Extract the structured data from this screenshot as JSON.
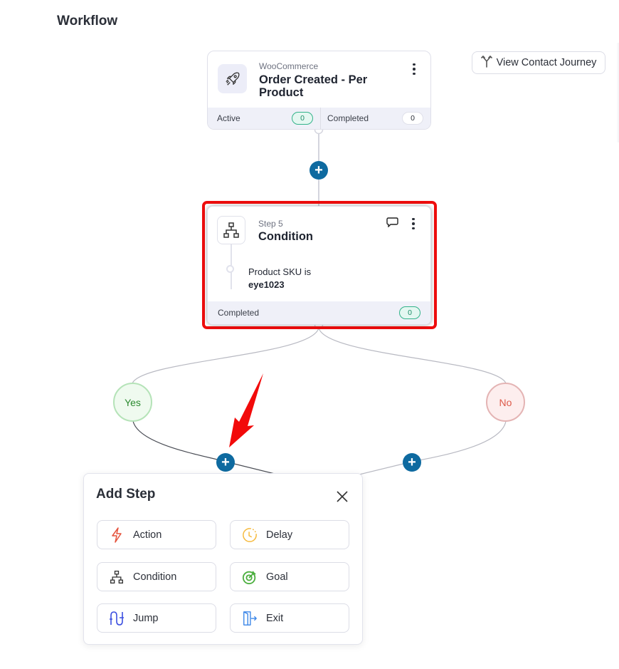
{
  "header": {
    "title": "Workflow"
  },
  "toolbar": {
    "view_journey_label": "View Contact Journey",
    "view_journey_icon": "branch-merge-icon"
  },
  "trigger": {
    "icon": "rocket-icon",
    "category": "WooCommerce",
    "title": "Order Created - Per Product",
    "stats": [
      {
        "label": "Active",
        "value": "0"
      },
      {
        "label": "Completed",
        "value": "0"
      }
    ]
  },
  "condition_step": {
    "icon": "sitemap-icon",
    "step_label": "Step 5",
    "title": "Condition",
    "rule_text": "Product SKU is",
    "rule_value": "eye1023",
    "completed_label": "Completed",
    "completed_value": "0"
  },
  "branches": {
    "yes": "Yes",
    "no": "No"
  },
  "colors": {
    "accent": "#0e6aa0",
    "highlight": "#ee0d0d",
    "yes": "#2b8a2f",
    "no": "#dd5a4a",
    "action": "#e5533d",
    "delay": "#f6b93b",
    "goal": "#4caf3f",
    "jump": "#3c4fe0",
    "exit": "#3b86e8"
  },
  "add_step": {
    "title": "Add Step",
    "options": [
      {
        "label": "Action",
        "icon": "lightning-icon"
      },
      {
        "label": "Delay",
        "icon": "clock-icon"
      },
      {
        "label": "Condition",
        "icon": "sitemap-icon"
      },
      {
        "label": "Goal",
        "icon": "target-icon"
      },
      {
        "label": "Jump",
        "icon": "jump-icon"
      },
      {
        "label": "Exit",
        "icon": "exit-door-icon"
      }
    ]
  }
}
